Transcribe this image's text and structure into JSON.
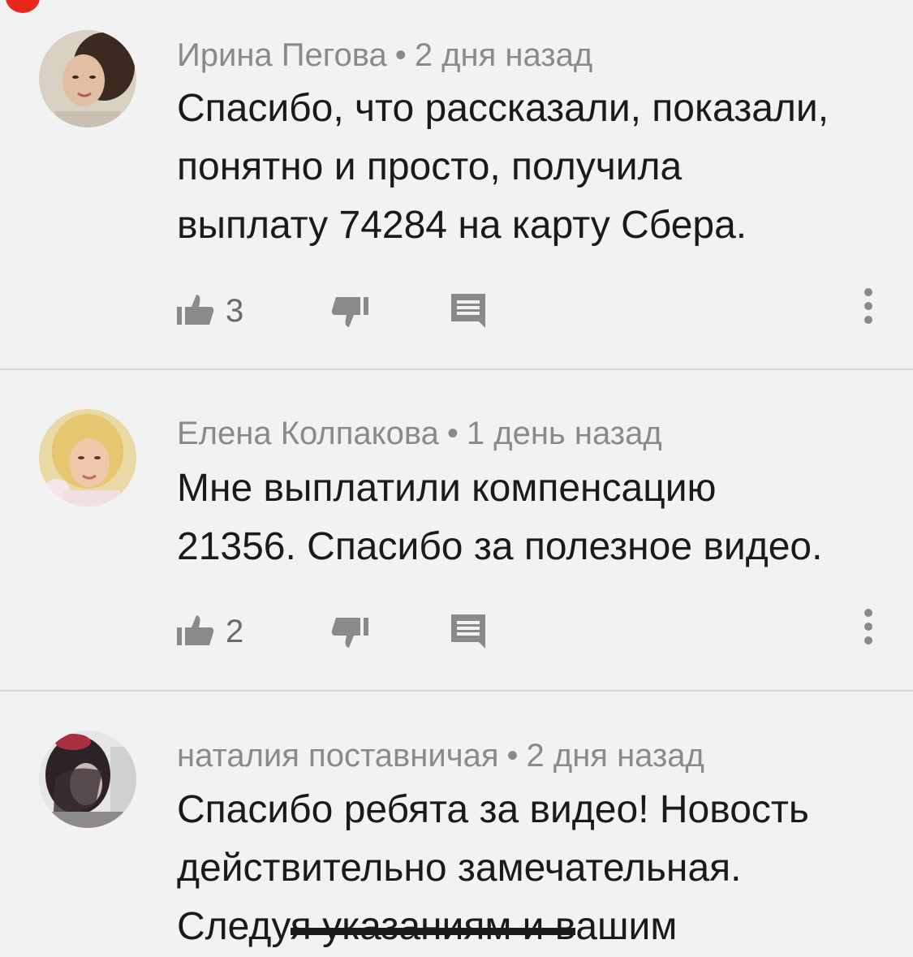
{
  "comments": [
    {
      "author": "Ирина Пегова",
      "separator": "•",
      "time": "2 дня назад",
      "lines": [
        "Спасибо, что рассказали, показали,",
        "понятно и просто, получила",
        "выплату 74284 на карту Сбера."
      ],
      "likes": "3"
    },
    {
      "author": "Елена Колпакова",
      "separator": "•",
      "time": "1 день назад",
      "lines": [
        "Мне выплатили компенсацию",
        "21356. Спасибо за полезное видео."
      ],
      "likes": "2"
    },
    {
      "author": "наталия поставничая",
      "separator": "•",
      "time": "2 дня назад",
      "lines": [
        "Спасибо ребята за видео! Новость",
        "действительно замечательная."
      ],
      "last_line_start": "Следу",
      "last_line_struck": "я указаниям и в",
      "last_line_end": "ашим"
    }
  ],
  "icons": {
    "like": "thumbs-up-icon",
    "dislike": "thumbs-down-icon",
    "reply": "reply-comment-icon",
    "more": "more-vertical-icon"
  },
  "colors": {
    "background": "#f2f2f2",
    "meta_text": "#8a8a8a",
    "body_text": "#1a1a1a",
    "icon": "#8a8a8a",
    "notification_dot": "#e8261a"
  }
}
